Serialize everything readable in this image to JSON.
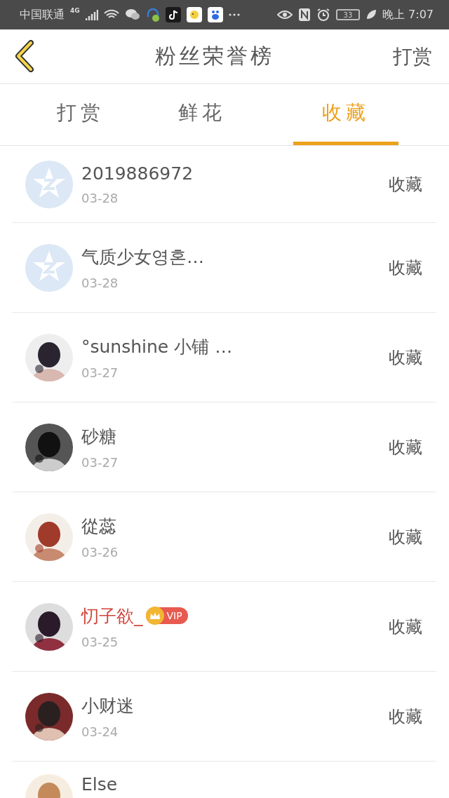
{
  "status_bar": {
    "carrier": "中国联通",
    "network": "4G",
    "battery": "33",
    "time": "晚上 7:07"
  },
  "header": {
    "title": "粉丝荣誉榜",
    "action": "打赏"
  },
  "tabs": [
    {
      "label": "打赏",
      "selected": false
    },
    {
      "label": "鲜花",
      "selected": false
    },
    {
      "label": "收藏",
      "selected": true
    }
  ],
  "rows": [
    {
      "kind": "default",
      "name": "2019886972",
      "vip": false,
      "date": "03-28",
      "action": "收藏"
    },
    {
      "kind": "default",
      "name": "气质少女영혼…",
      "vip": false,
      "date": "03-28",
      "action": "收藏"
    },
    {
      "kind": "picture",
      "name": "°sunshine 小铺 …",
      "vip": false,
      "date": "03-27",
      "action": "收藏"
    },
    {
      "kind": "picture",
      "name": "砂糖",
      "vip": false,
      "date": "03-27",
      "action": "收藏"
    },
    {
      "kind": "picture",
      "name": "從蕊",
      "vip": false,
      "date": "03-26",
      "action": "收藏"
    },
    {
      "kind": "picture",
      "name": "忉子欲_",
      "vip": true,
      "vip_label": "VIP",
      "date": "03-25",
      "action": "收藏"
    },
    {
      "kind": "picture",
      "name": "小财迷",
      "vip": false,
      "date": "03-24",
      "action": "收藏"
    },
    {
      "kind": "picture",
      "name": "Else",
      "vip": false
    }
  ]
}
